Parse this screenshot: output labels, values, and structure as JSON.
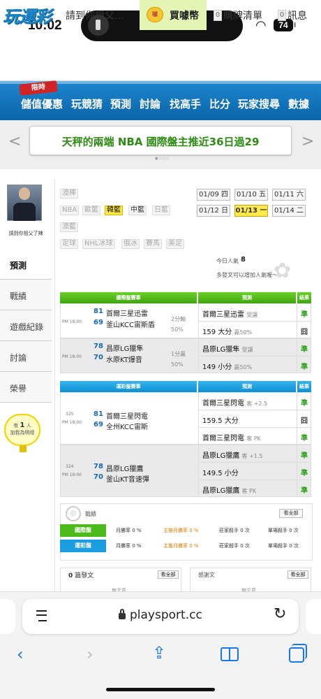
{
  "status_bar": {
    "time": "10:02",
    "battery": "74"
  },
  "header": {
    "logo": "玩運彩",
    "user_link": "請到你祖父...",
    "buy_label": "買噱幣",
    "coin_label": "噱",
    "cart_count": "0",
    "cart_label": "購牌清單",
    "msg_count": "0",
    "msg_label": "訊息"
  },
  "nav": {
    "badge": "限時",
    "items": [
      "儲值優惠",
      "玩競猜",
      "預測",
      "討論",
      "找高手",
      "比分",
      "玩家搜尋",
      "數據"
    ]
  },
  "banner": {
    "text": "天秤的兩端 NBA 國際盤主推近36日過29",
    "prev": "<",
    "next": ">"
  },
  "sidebar": {
    "avatar_name": "請到你祖父了辣",
    "tabs": [
      "預測",
      "戰績",
      "遊戲紀錄",
      "討論",
      "榮譽"
    ],
    "bulb_prefix": "有",
    "bulb_count": "1",
    "bulb_suffix": "人",
    "bulb_line2": "加我為明燈"
  },
  "sports": {
    "row1": [
      "澳棒"
    ],
    "row2": [
      "NBA",
      "歐籃",
      "韓籃",
      "中籃",
      "日籃"
    ],
    "row3": [
      "澳籃"
    ],
    "row4": [
      "足球",
      "NHL冰球",
      "俄冰",
      "賽馬",
      "美足"
    ],
    "active": "韓籃"
  },
  "dates": [
    "01/09 四",
    "01/10 五",
    "01/11 六",
    "01/12 日",
    "01/13 一",
    "01/14 二"
  ],
  "popularity": {
    "label": "今日人氣",
    "value": "8",
    "hint": "多發文可以增加人氣喔～"
  },
  "intl_table": {
    "header": {
      "game": "國際盤賽事",
      "pred": "預測",
      "result": "結果"
    },
    "games": [
      {
        "time": "PM 18:00",
        "n1": "81",
        "t1": "首爾三星迅雷",
        "n2": "69",
        "t2": "釜山KCC宙斯盾",
        "line": "2分輸",
        "pct": "50%",
        "picks": [
          {
            "pick": "首爾三星迅雷",
            "sub": "受讓",
            "result": "準"
          },
          {
            "pick": "159 大分",
            "sub": "贏50%",
            "result": "囧"
          }
        ]
      },
      {
        "time": "PM 18:00",
        "n1": "78",
        "t1": "昌原LG獵隼",
        "n2": "70",
        "t2": "水原KT爆音",
        "line": "1分贏",
        "pct": "50%",
        "picks": [
          {
            "pick": "昌原LG獵隼",
            "sub": "受讓",
            "result": "準"
          },
          {
            "pick": "149 小分",
            "sub": "贏50%",
            "result": "準"
          }
        ]
      }
    ]
  },
  "sport_table": {
    "header": {
      "game": "運彩盤賽事",
      "pred": "預測",
      "result": "結果"
    },
    "games": [
      {
        "id": "325",
        "time": "PM 18:00",
        "n1": "81",
        "t1": "首爾三星閃電",
        "n2": "69",
        "t2": "全州KCC宙斯",
        "picks": [
          {
            "pick": "首爾三星閃電",
            "sub": "客 +2.5",
            "result": "準"
          },
          {
            "pick": "159.5 大分",
            "sub": "",
            "result": "囧"
          },
          {
            "pick": "首爾三星閃電",
            "sub": "客 PK",
            "result": "準"
          }
        ]
      },
      {
        "id": "324",
        "time": "PM 18:00",
        "n1": "78",
        "t1": "昌原LG獵鷹",
        "n2": "70",
        "t2": "釜山KT音速彈",
        "picks": [
          {
            "pick": "昌原LG獵鷹",
            "sub": "客 +1.5",
            "result": "準"
          },
          {
            "pick": "149.5 小分",
            "sub": "",
            "result": "準"
          },
          {
            "pick": "昌原LG獵鷹",
            "sub": "客 PK",
            "result": "準"
          }
        ]
      }
    ]
  },
  "stats": {
    "title": "戰績",
    "view_all": "看全部",
    "rows": [
      {
        "label": "國際盤",
        "cells": [
          "月勝率 0 %",
          "主推月勝率 0 %",
          "莊家殺手 0 次",
          "單場殺手 0 次"
        ]
      },
      {
        "label": "運彩盤",
        "cells": [
          "月勝率 0 %",
          "主推月勝率 0 %",
          "莊家殺手 0 次",
          "單場殺手 0 次"
        ]
      }
    ]
  },
  "posts_box": {
    "count": "0",
    "label": "篇發文",
    "view_all": "看全部",
    "empty": "無文章"
  },
  "thanks_box": {
    "label": "感謝文",
    "view_all": "看全部",
    "empty": "無文章"
  },
  "safari": {
    "url": "playsport.cc"
  }
}
